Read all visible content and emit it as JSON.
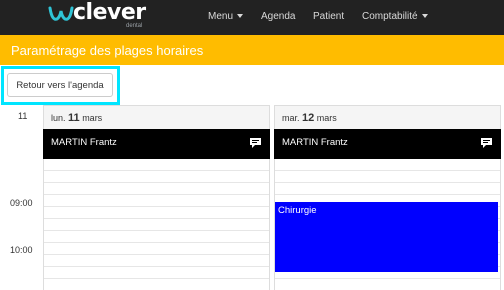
{
  "navbar": {
    "logo_text": "clever",
    "logo_sub": "dental",
    "menu_label": "Menu",
    "agenda_label": "Agenda",
    "patient_label": "Patient",
    "compta_label": "Comptabilité"
  },
  "page": {
    "title": "Paramétrage des plages horaires"
  },
  "back_button": {
    "label": "Retour vers l'agenda"
  },
  "times": {
    "t11": "11",
    "t0900": "09:00",
    "t1000": "10:00"
  },
  "days": [
    {
      "prefix": "lun.",
      "num": "11",
      "month": "mars",
      "person": "MARTIN Frantz"
    },
    {
      "prefix": "mar.",
      "num": "12",
      "month": "mars",
      "person": "MARTIN Frantz",
      "event": "Chirurgie"
    }
  ],
  "colors": {
    "navbar": "#222222",
    "accent": "#ffbc00",
    "event": "#0000ff",
    "highlight": "#00e5ff"
  }
}
